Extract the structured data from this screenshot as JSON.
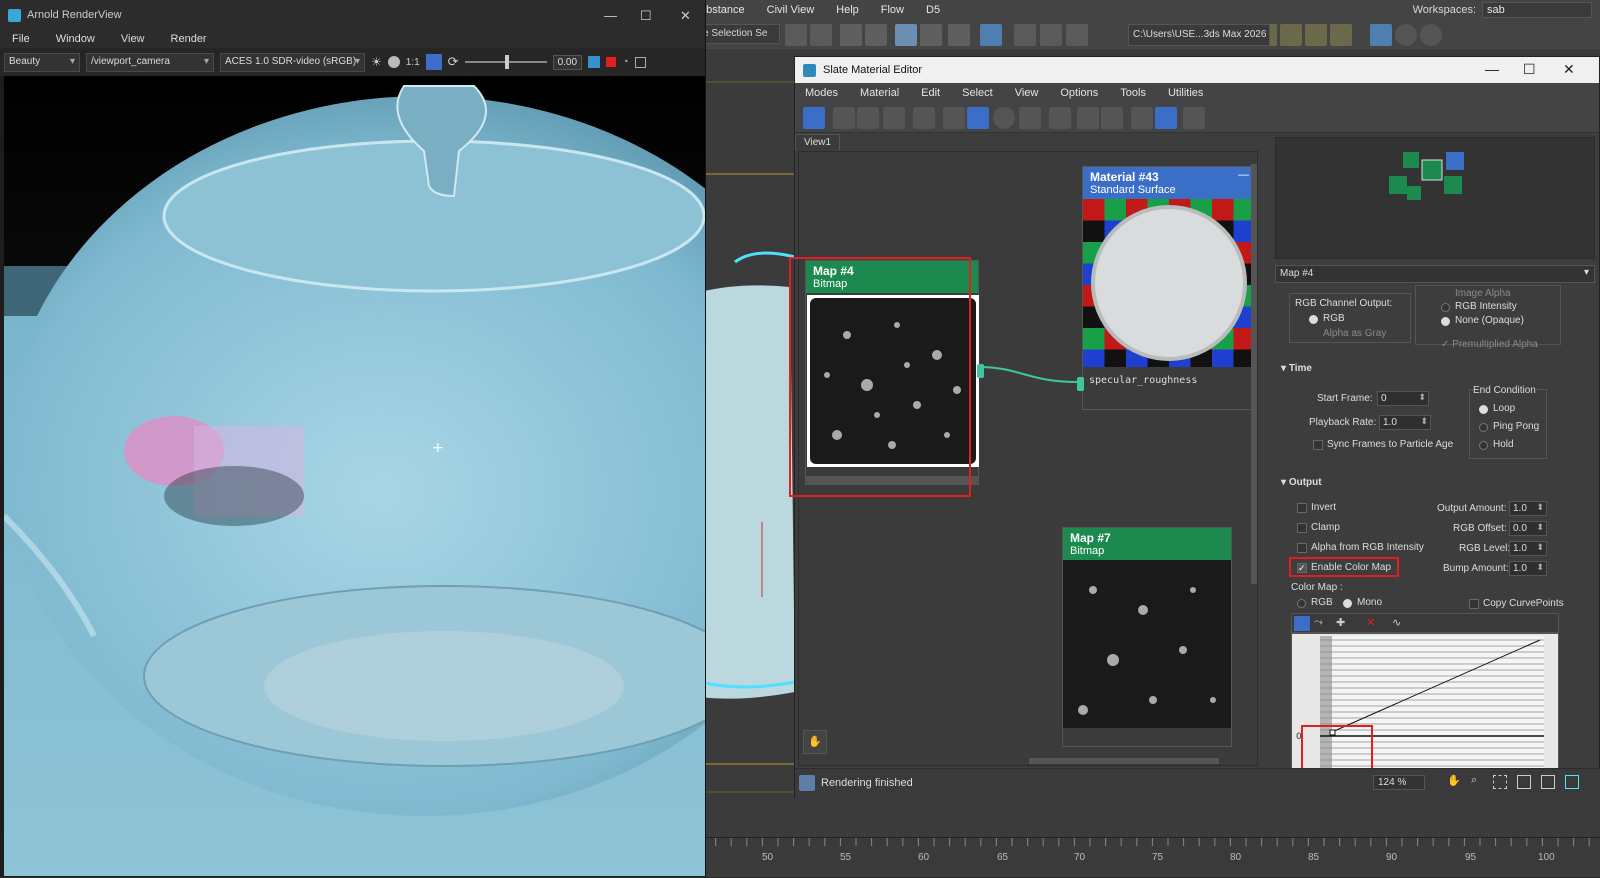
{
  "max": {
    "menu": [
      "ubstance",
      "Civil View",
      "Help",
      "Flow",
      "D5"
    ],
    "workspaces_label": "Workspaces:",
    "workspaces_value": "sab",
    "selection_set": "e Selection Se",
    "path": "C:\\Users\\USE...3ds Max 2026",
    "timeline_ticks": [
      "50",
      "55",
      "60",
      "65",
      "70",
      "75",
      "80",
      "85",
      "90",
      "95",
      "100"
    ]
  },
  "arnold": {
    "title": "Arnold RenderView",
    "menu": [
      "File",
      "Window",
      "View",
      "Render"
    ],
    "aov": "Beauty",
    "camera": "/viewport_camera",
    "color_space": "ACES 1.0 SDR-video (sRGB)",
    "ratio": "1:1",
    "exposure": "0.00"
  },
  "sme": {
    "title": "Slate Material Editor",
    "menu": [
      "Modes",
      "Material",
      "Edit",
      "Select",
      "View",
      "Options",
      "Tools",
      "Utilities"
    ],
    "tab": "View1",
    "nodes": {
      "map4": {
        "name": "Map #4",
        "type": "Bitmap"
      },
      "mat43": {
        "name": "Material #43",
        "type": "Standard Surface",
        "slot": "specular_roughness"
      },
      "map7": {
        "name": "Map #7",
        "type": "Bitmap"
      }
    },
    "status": "Rendering finished",
    "zoom": "124 %",
    "panel": {
      "map_select": "Map #4",
      "image_alpha": "Image Alpha",
      "rgb_channel_output": "RGB Channel Output:",
      "rgb": "RGB",
      "alpha_as_gray": "Alpha as Gray",
      "rgb_intensity": "RGB Intensity",
      "none_opaque": "None (Opaque)",
      "premultiplied": "Premultiplied Alpha",
      "time_header": "Time",
      "start_frame_label": "Start Frame:",
      "start_frame": "0",
      "playback_rate_label": "Playback Rate:",
      "playback_rate": "1.0",
      "end_condition": "End Condition",
      "loop": "Loop",
      "ping_pong": "Ping Pong",
      "hold": "Hold",
      "sync_frames": "Sync Frames to Particle Age",
      "output_header": "Output",
      "invert": "Invert",
      "clamp": "Clamp",
      "alpha_from_rgb": "Alpha from RGB Intensity",
      "enable_color_map": "Enable Color Map",
      "output_amount_label": "Output Amount:",
      "output_amount": "1.0",
      "rgb_offset_label": "RGB Offset:",
      "rgb_offset": "0.0",
      "rgb_level_label": "RGB Level:",
      "rgb_level": "1.0",
      "bump_amount_label": "Bump Amount:",
      "bump_amount": "1.0",
      "color_map_label": "Color Map :",
      "cm_rgb": "RGB",
      "cm_mono": "Mono",
      "copy_curve_points": "Copy CurvePoints",
      "curve_axis_zero": "0"
    }
  },
  "colors": {
    "node_green": "#1c8a4e",
    "node_blue": "#3b6fc7",
    "highlight_red": "#e02020",
    "wire": "#3fc6a0"
  }
}
